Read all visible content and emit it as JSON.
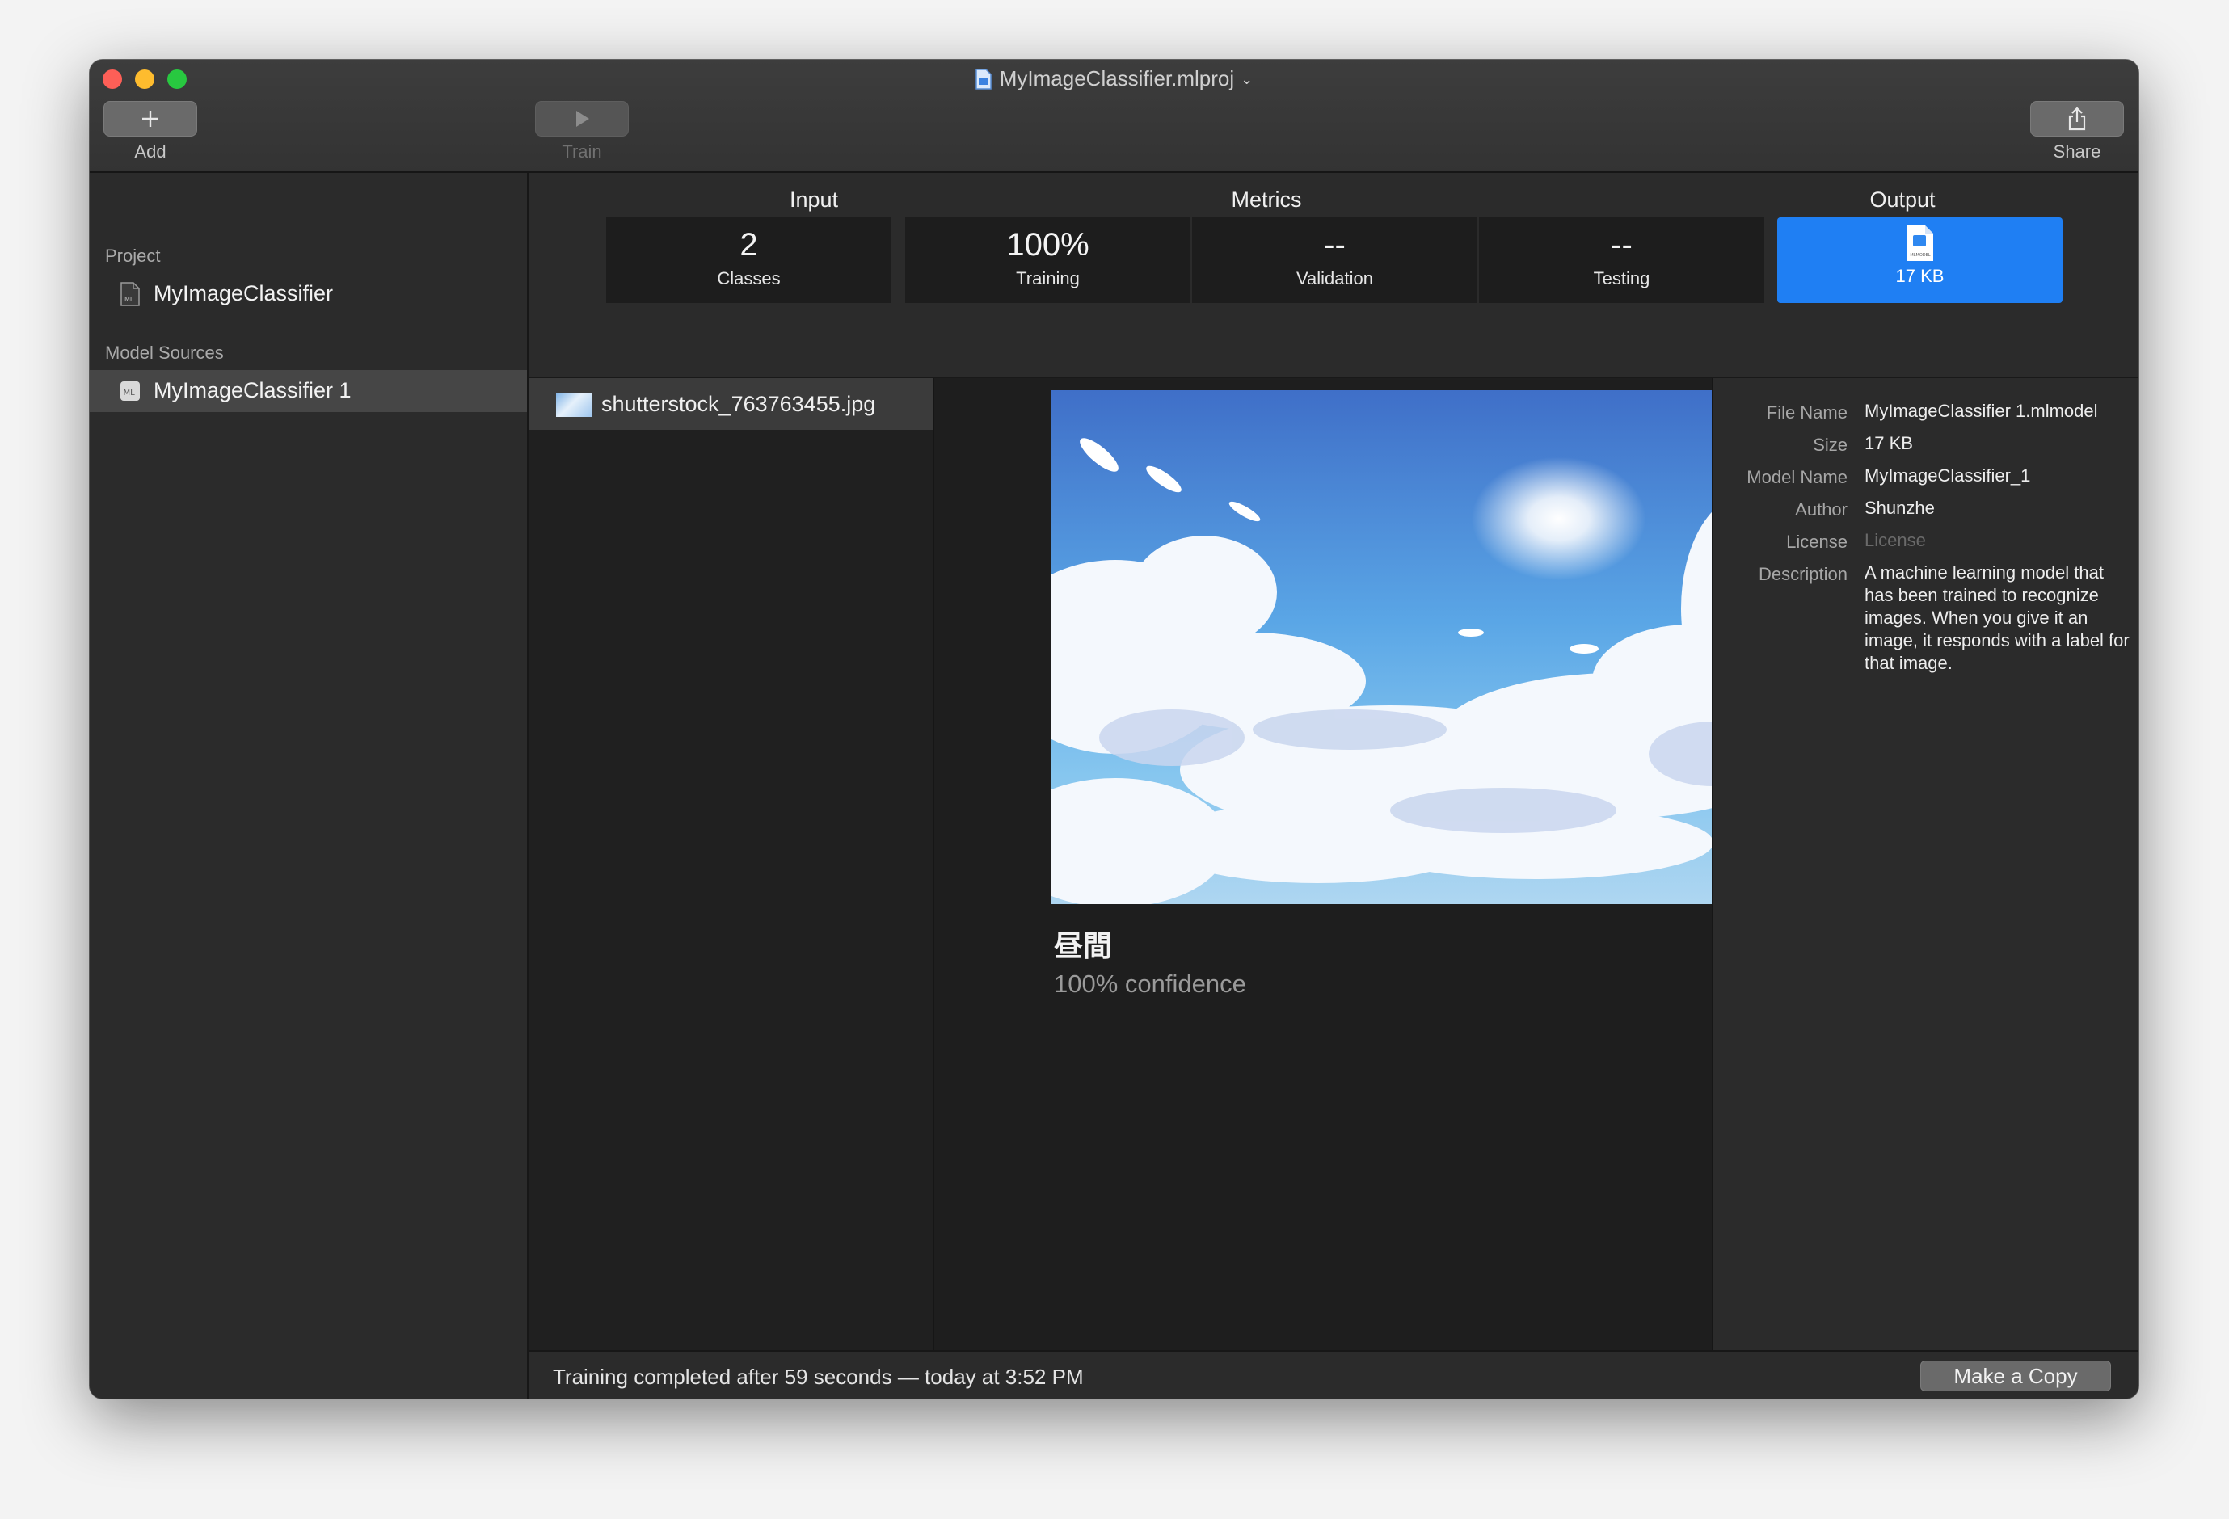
{
  "window": {
    "title": "MyImageClassifier.mlproj"
  },
  "toolbar": {
    "add_label": "Add",
    "train_label": "Train",
    "share_label": "Share"
  },
  "sidebar": {
    "project_header": "Project",
    "project_item": "MyImageClassifier",
    "sources_header": "Model Sources",
    "source_items": [
      {
        "label": "MyImageClassifier 1",
        "selected": true
      }
    ]
  },
  "sections": {
    "input_title": "Input",
    "metrics_title": "Metrics",
    "output_title": "Output"
  },
  "tiles": {
    "classes_value": "2",
    "classes_label": "Classes",
    "training_value": "100%",
    "training_label": "Training",
    "validation_value": "--",
    "validation_label": "Validation",
    "testing_value": "--",
    "testing_label": "Testing",
    "output_size": "17 KB",
    "output_icon_text": "MLMODEL"
  },
  "file_list": {
    "items": [
      "shutterstock_763763455.jpg"
    ],
    "add_symbol": "+"
  },
  "prediction": {
    "label": "昼間",
    "confidence": "100% confidence"
  },
  "info": {
    "file_name_key": "File Name",
    "file_name_val": "MyImageClassifier 1.mlmodel",
    "size_key": "Size",
    "size_val": "17 KB",
    "model_name_key": "Model Name",
    "model_name_val": "MyImageClassifier_1",
    "author_key": "Author",
    "author_val": "Shunzhe",
    "license_key": "License",
    "license_placeholder": "License",
    "description_key": "Description",
    "description_val": "A machine learning model that has been trained to recognize images. When you give it an image, it responds with a label for that image."
  },
  "status": {
    "text": "Training completed after 59 seconds — today at 3:52 PM",
    "make_copy_label": "Make a Copy"
  },
  "colors": {
    "accent": "#1f7ff3",
    "close": "#fe5f57",
    "minimize": "#febc2e",
    "zoom": "#28c840"
  }
}
